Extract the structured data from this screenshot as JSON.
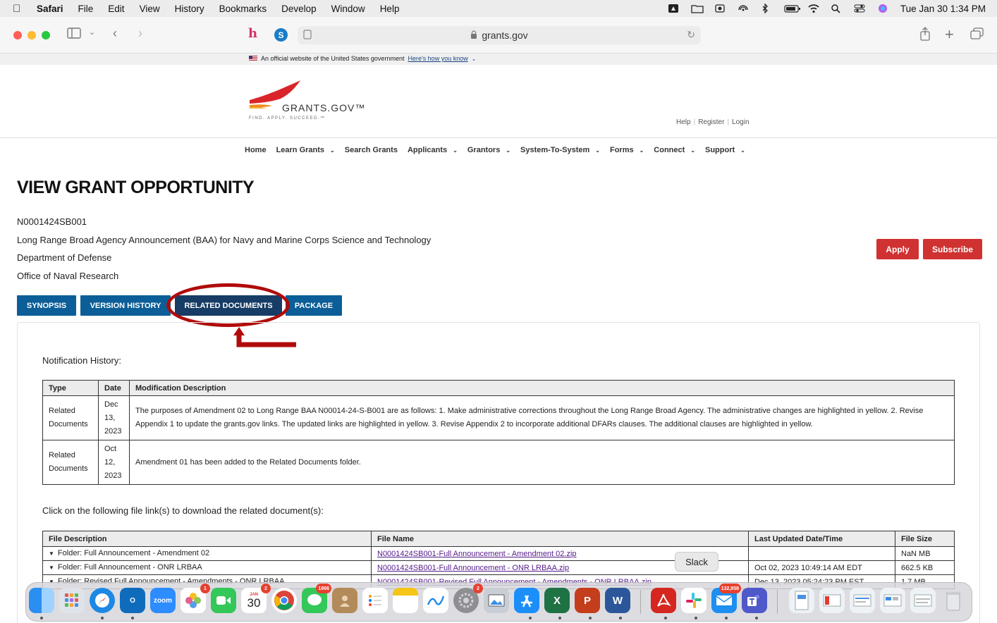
{
  "menubar": {
    "app": "Safari",
    "items": [
      "File",
      "Edit",
      "View",
      "History",
      "Bookmarks",
      "Develop",
      "Window",
      "Help"
    ],
    "clock": "Tue Jan 30  1:34 PM"
  },
  "browser": {
    "url": "grants.gov"
  },
  "gov_banner": {
    "text": "An official website of the United States government",
    "link": "Here's how you know"
  },
  "header": {
    "logo_text": "GRANTS.GOV™",
    "tagline": "FIND. APPLY. SUCCEED.™",
    "util_links": [
      "Help",
      "Register",
      "Login"
    ]
  },
  "nav": {
    "items": [
      {
        "label": "Home",
        "dropdown": false
      },
      {
        "label": "Learn Grants",
        "dropdown": true
      },
      {
        "label": "Search Grants",
        "dropdown": false
      },
      {
        "label": "Applicants",
        "dropdown": true
      },
      {
        "label": "Grantors",
        "dropdown": true
      },
      {
        "label": "System-To-System",
        "dropdown": true
      },
      {
        "label": "Forms",
        "dropdown": true
      },
      {
        "label": "Connect",
        "dropdown": true
      },
      {
        "label": "Support",
        "dropdown": true
      }
    ]
  },
  "page": {
    "title": "VIEW GRANT OPPORTUNITY",
    "opportunity_number": "N0001424SB001",
    "opportunity_title": "Long Range Broad Agency Announcement (BAA) for Navy and Marine Corps Science and Technology",
    "agency": "Department of Defense",
    "office": "Office of Naval Research",
    "apply_label": "Apply",
    "subscribe_label": "Subscribe",
    "tabs": [
      "SYNOPSIS",
      "VERSION HISTORY",
      "RELATED DOCUMENTS",
      "PACKAGE"
    ],
    "active_tab": "RELATED DOCUMENTS"
  },
  "notification": {
    "label": "Notification History:",
    "headers": [
      "Type",
      "Date",
      "Modification Description"
    ],
    "rows": [
      {
        "type": "Related Documents",
        "date": "Dec 13, 2023",
        "description": "The purposes of Amendment 02 to Long Range BAA N00014-24-S-B001 are as follows: 1. Make administrative corrections throughout the Long Range Broad Agency. The administrative changes are highlighted in yellow. 2. Revise Appendix 1 to update the grants.gov links. The updated links are highlighted in yellow. 3. Revise Appendix 2 to incorporate additional DFARs clauses. The additional clauses are highlighted in yellow."
      },
      {
        "type": "Related Documents",
        "date": "Oct 12, 2023",
        "description": "Amendment 01 has been added to the Related Documents folder."
      }
    ]
  },
  "files": {
    "label": "Click on the following file link(s) to download the related document(s):",
    "headers": [
      "File Description",
      "File Name",
      "Last Updated Date/Time",
      "File Size"
    ],
    "rows": [
      {
        "description": "Folder: Full Announcement - Amendment 02",
        "name": "N0001424SB001-Full Announcement - Amendment 02.zip",
        "updated": "",
        "size": "NaN MB"
      },
      {
        "description": "Folder: Full Announcement - ONR LRBAA",
        "name": "N0001424SB001-Full Announcement - ONR LRBAA.zip",
        "updated": "Oct 02, 2023 10:49:14 AM EDT",
        "size": "662.5 KB"
      },
      {
        "description": "Folder: Revised Full Announcement - Amendments - ONR LRBAA",
        "name": "N0001424SB001-Revised Full Announcement - Amendments - ONR LRBAA.zip",
        "updated": "Dec 13, 2023 05:24:23 PM EST",
        "size": "1.7 MB"
      }
    ]
  },
  "tooltip": "Slack",
  "dock": {
    "calendar_month": "JAN",
    "calendar_day": "30",
    "zoom_label": "zoom",
    "badges": {
      "photos": "1",
      "calendar": "2",
      "messages": "1866",
      "settings": "2",
      "mail": "132,858"
    }
  }
}
